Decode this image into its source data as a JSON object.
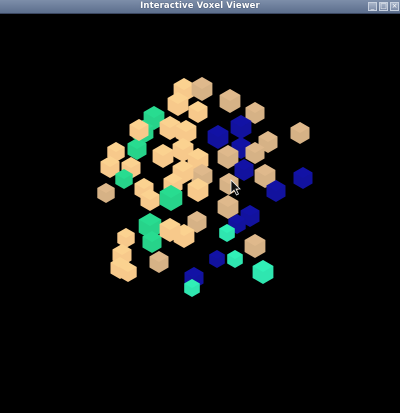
{
  "window": {
    "title": "Interactive Voxel Viewer",
    "buttons": {
      "minimize": "_",
      "maximize": "□",
      "close": "×"
    }
  },
  "scene": {
    "background": "#000000",
    "palette": {
      "peach": "#f7c98b",
      "tan": "#d6b286",
      "green": "#27d38a",
      "aqua": "#2fe6b0",
      "navy": "#12129e"
    },
    "mouse_pointer": "arrow-pointer-icon"
  }
}
